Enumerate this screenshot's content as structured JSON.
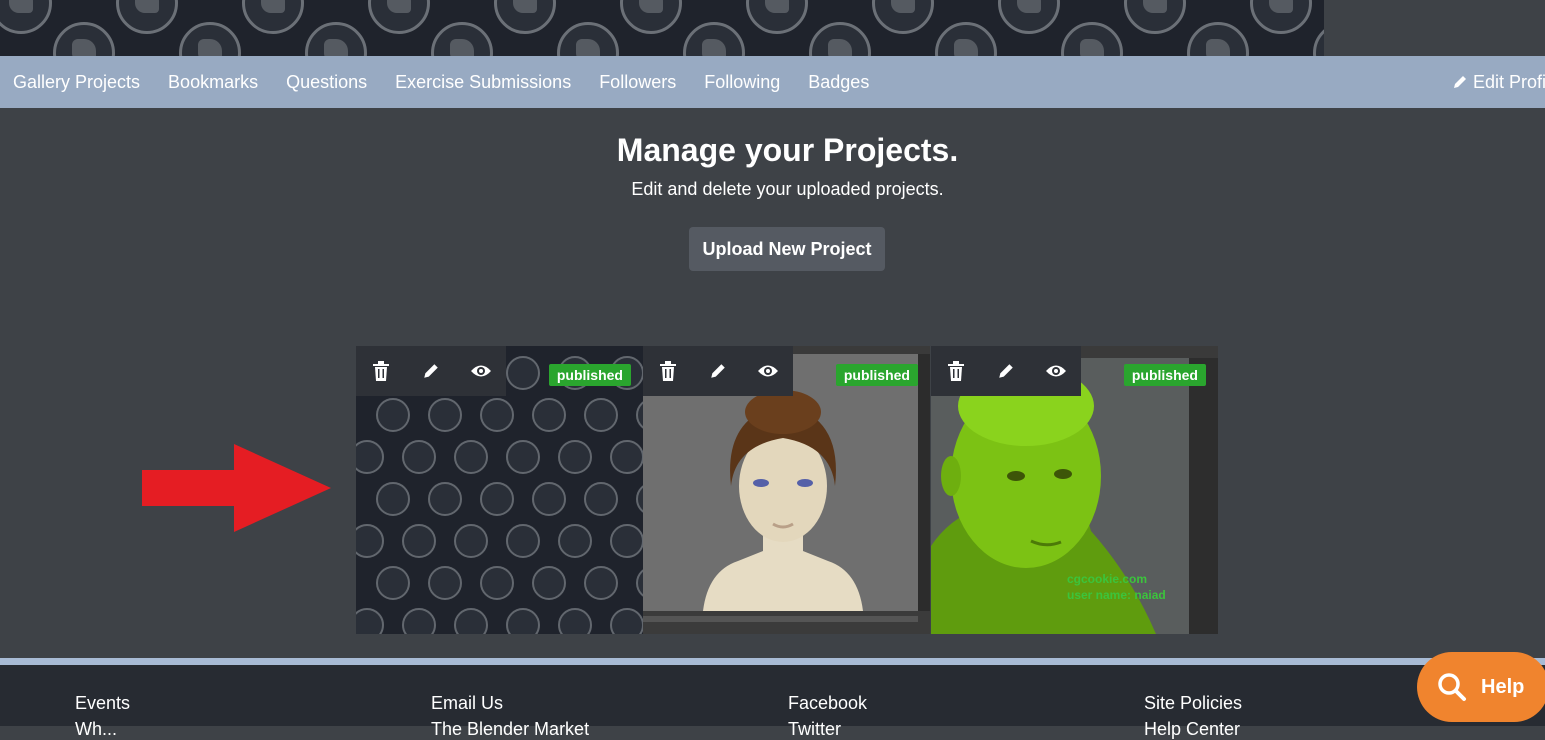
{
  "nav": {
    "items": [
      "Gallery Projects",
      "Bookmarks",
      "Questions",
      "Exercise Submissions",
      "Followers",
      "Following",
      "Badges"
    ],
    "edit_profile_label": "Edit Profi"
  },
  "main": {
    "title": "Manage your Projects.",
    "subtitle": "Edit and delete your uploaded projects.",
    "upload_button": "Upload New Project"
  },
  "projects": [
    {
      "status": "published",
      "image": "pattern-placeholder"
    },
    {
      "status": "published",
      "image": "female-head-render"
    },
    {
      "status": "published",
      "image": "green-head-render",
      "watermark": [
        "cgcookie.com",
        "user name: naiad"
      ]
    }
  ],
  "icons": {
    "delete": "trash-icon",
    "edit": "pencil-icon",
    "view": "eye-icon",
    "arrow": "red-arrow-right"
  },
  "footer": {
    "columns": [
      {
        "title": "Events",
        "sub": "Wh..."
      },
      {
        "title": "Email Us",
        "sub": "The Blender Market"
      },
      {
        "title": "Facebook",
        "sub": "Twitter"
      },
      {
        "title": "Site Policies",
        "sub": "Help Center"
      }
    ]
  },
  "help": {
    "label": "Help"
  },
  "colors": {
    "nav_bg": "#98aac2",
    "page_bg": "#3e4247",
    "badge": "#2aa52e",
    "help": "#f0842e",
    "arrow": "#e51d23"
  }
}
